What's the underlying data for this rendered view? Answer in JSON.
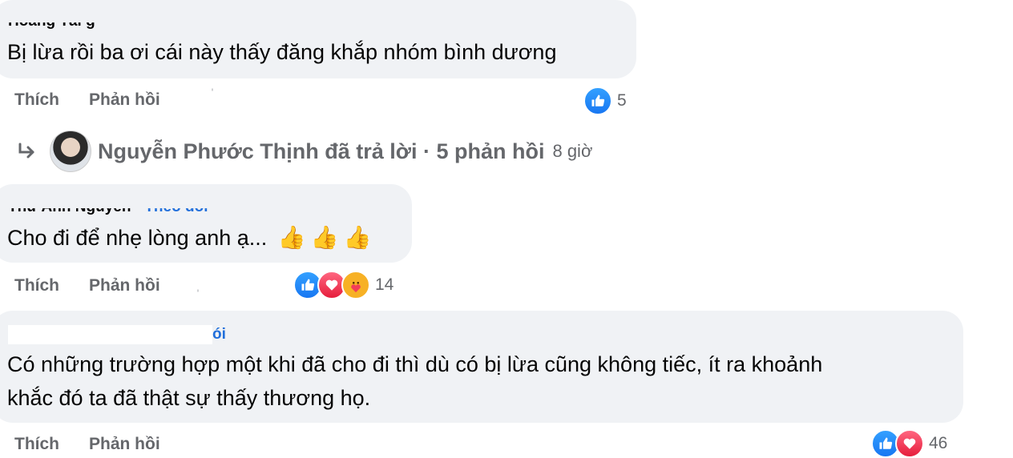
{
  "comments": [
    {
      "author": "Hoàng Tài g",
      "text_lines": [
        "Bị lừa rồi ba ơi cái này thấy đăng khắp nhóm bình dương"
      ],
      "like_label": "Thích",
      "reply_label": "Phản hồi",
      "reactions": [
        "like"
      ],
      "reaction_count": "5"
    },
    {
      "author": "Thư Anh Nguyễn",
      "follow_label": "Theo dõi",
      "text_lines": [
        "Cho đi để nhẹ lòng anh ạ..."
      ],
      "emoji": [
        "👍",
        "👍",
        "👍"
      ],
      "like_label": "Thích",
      "reply_label": "Phản hồi",
      "reactions": [
        "like",
        "love",
        "care"
      ],
      "reaction_count": "14"
    },
    {
      "author": "",
      "follow_label": "ói",
      "text_lines": [
        "Có những trường hợp một khi đã cho đi thì dù có bị lừa cũng không tiếc, ít ra khoảnh",
        "khắc đó ta đã thật sự thấy thương họ."
      ],
      "like_label": "Thích",
      "reply_label": "Phản hồi",
      "reactions": [
        "like",
        "love"
      ],
      "reaction_count": "46"
    }
  ],
  "thread": {
    "text": "Nguyễn Phước Thịnh đã trả lời · 5 phản hồi",
    "time": "8 giờ"
  },
  "colors": {
    "bubble": "#f0f2f5",
    "secondary_text": "#65676b",
    "like_blue": "#1877f2",
    "love_red": "#e61e3c",
    "care_yellow": "#f7b125"
  }
}
